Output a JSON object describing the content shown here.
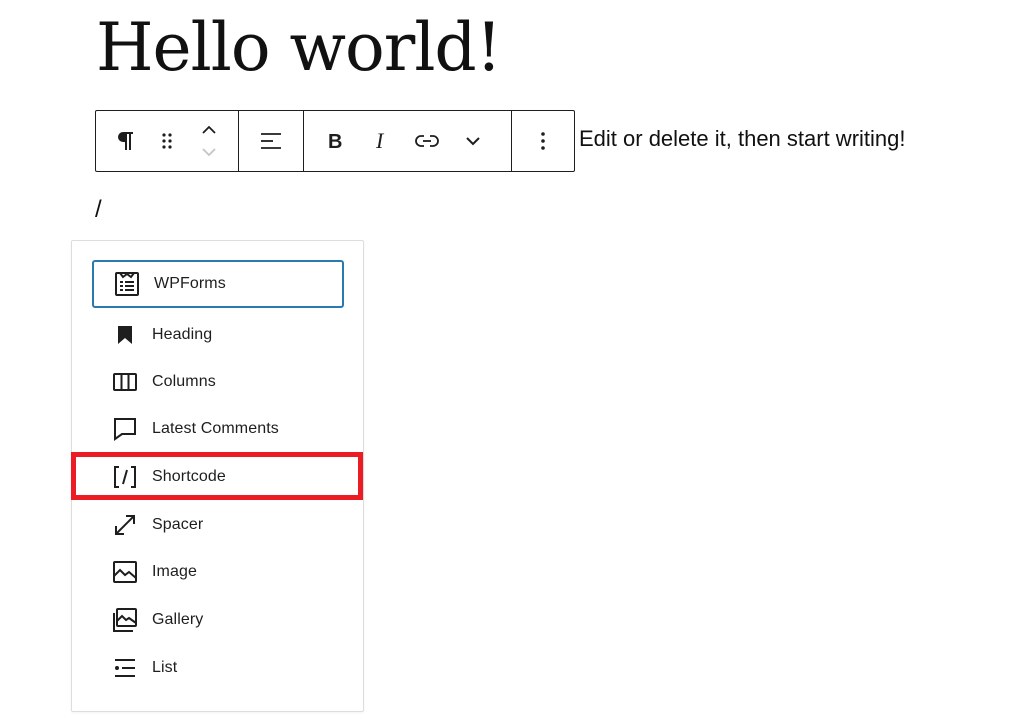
{
  "post": {
    "title": "Hello world!",
    "paragraph": "Edit or delete it, then start writing!",
    "slash_text": "/"
  },
  "toolbar": {
    "buttons": [
      "paragraph-icon",
      "drag-handle-icon",
      "move-up-down-icon",
      "align-icon",
      "bold-icon",
      "italic-icon",
      "link-icon",
      "more-chevron-icon",
      "options-kebab-icon"
    ]
  },
  "inserter": {
    "items": [
      {
        "label": "WPForms",
        "icon": "wpforms-icon"
      },
      {
        "label": "Heading",
        "icon": "bookmark-icon"
      },
      {
        "label": "Columns",
        "icon": "columns-icon"
      },
      {
        "label": "Latest Comments",
        "icon": "comment-icon"
      },
      {
        "label": "Shortcode",
        "icon": "shortcode-icon"
      },
      {
        "label": "Spacer",
        "icon": "resize-arrow-icon"
      },
      {
        "label": "Image",
        "icon": "image-icon"
      },
      {
        "label": "Gallery",
        "icon": "gallery-icon"
      },
      {
        "label": "List",
        "icon": "list-icon"
      }
    ]
  },
  "colors": {
    "selected_border": "#2a7ab0",
    "highlight_annotation": "#ec1c24"
  }
}
